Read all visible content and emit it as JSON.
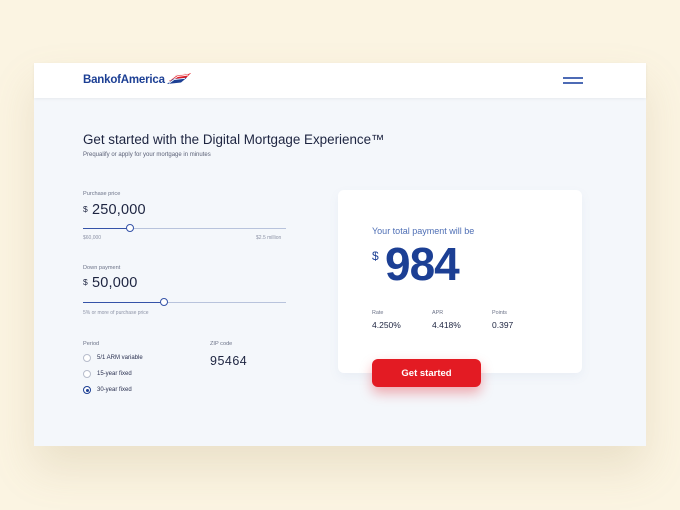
{
  "brand": {
    "name": "Bank of America",
    "logo_text": "BankofAmerica"
  },
  "header": {
    "menu_icon": "hamburger-menu-icon"
  },
  "hero": {
    "title": "Get started with the Digital Mortgage Experience™",
    "subtitle": "Prequalify or apply for your mortgage in minutes"
  },
  "purchase_price": {
    "label": "Purchase price",
    "currency": "$",
    "value": "250,000",
    "min_label": "$60,000",
    "max_label": "$2.5 million",
    "slider_fraction": 0.23
  },
  "down_payment": {
    "label": "Down payment",
    "currency": "$",
    "value": "50,000",
    "hint": "5% or more of purchase price",
    "slider_fraction": 0.4
  },
  "period": {
    "label": "Period",
    "options": [
      {
        "label": "5/1 ARM variable",
        "selected": false
      },
      {
        "label": "15-year fixed",
        "selected": false
      },
      {
        "label": "30-year fixed",
        "selected": true
      }
    ]
  },
  "zip": {
    "label": "ZIP code",
    "value": "95464"
  },
  "payment": {
    "title": "Your total payment will be",
    "currency": "$",
    "amount": "984",
    "stats": [
      {
        "label": "Rate",
        "value": "4.250%"
      },
      {
        "label": "APR",
        "value": "4.418%"
      },
      {
        "label": "Points",
        "value": "0.397"
      }
    ]
  },
  "cta": {
    "label": "Get started"
  },
  "colors": {
    "background": "#fbf4e2",
    "brand_blue": "#1c3f94",
    "accent_red": "#e31b23"
  }
}
